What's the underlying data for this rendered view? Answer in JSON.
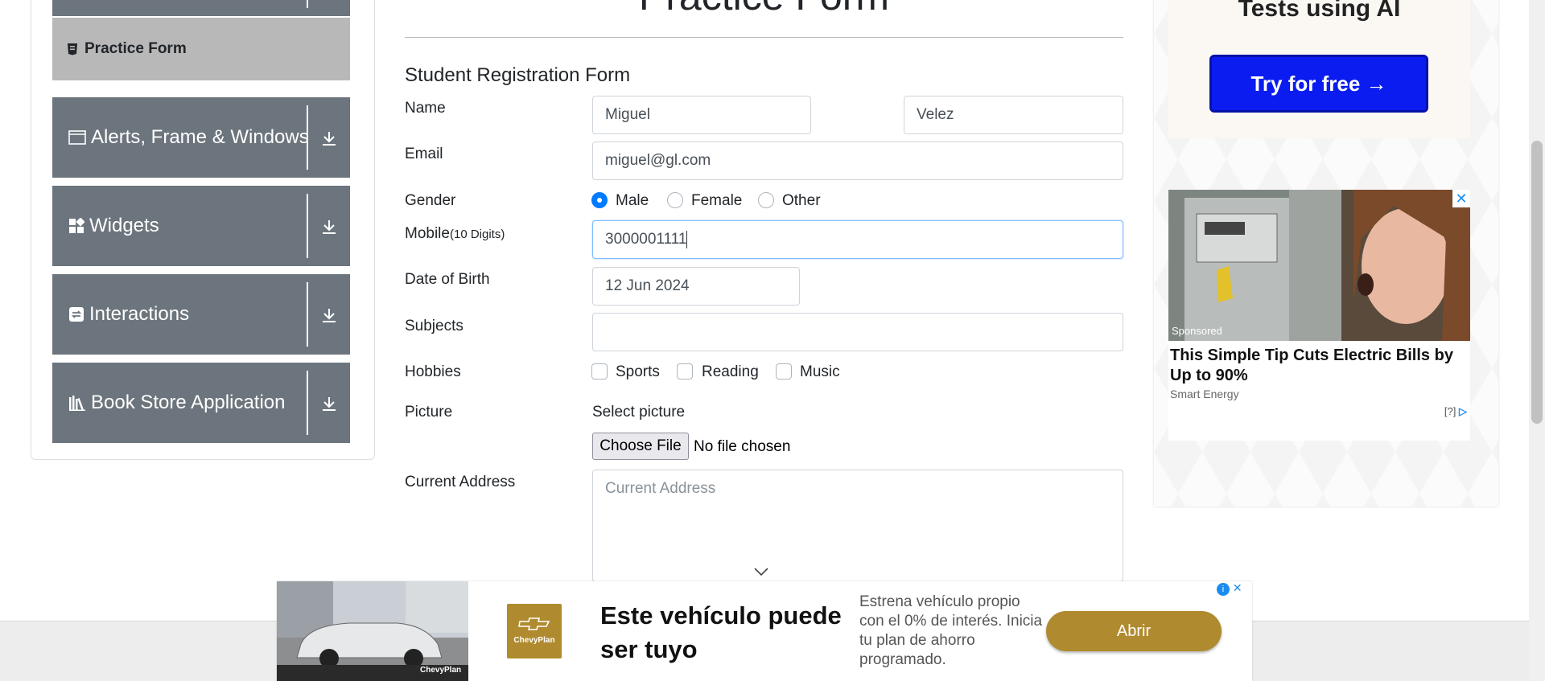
{
  "sidebar": {
    "active_item": "Practice Form",
    "groups": [
      {
        "label": "Alerts, Frame & Windows",
        "icon": "window-icon"
      },
      {
        "label": "Widgets",
        "icon": "widgets-icon"
      },
      {
        "label": "Interactions",
        "icon": "interactions-icon"
      },
      {
        "label": "Book Store Application",
        "icon": "books-icon"
      }
    ]
  },
  "main": {
    "page_title": "Practice Form",
    "form_title": "Student Registration Form",
    "labels": {
      "name": "Name",
      "email": "Email",
      "gender": "Gender",
      "mobile": "Mobile",
      "mobile_hint": "(10 Digits)",
      "dob": "Date of Birth",
      "subjects": "Subjects",
      "hobbies": "Hobbies",
      "picture": "Picture",
      "address": "Current Address"
    },
    "values": {
      "first_name": "Miguel",
      "last_name": "Velez",
      "email": "miguel@gl.com",
      "mobile": "3000001111",
      "dob": "12 Jun 2024",
      "subjects": ""
    },
    "gender_options": [
      "Male",
      "Female",
      "Other"
    ],
    "gender_selected": "Male",
    "hobby_options": [
      "Sports",
      "Reading",
      "Music"
    ],
    "picture": {
      "select_label": "Select picture",
      "button_label": "Choose File",
      "status": "No file chosen"
    },
    "address_placeholder": "Current Address"
  },
  "right_ads": {
    "top_text": "Tests using AI",
    "try_button": "Try for free →",
    "sponsored": "Sponsored",
    "headline": "This Simple Tip Cuts Electric Bills by Up to 90%",
    "brand": "Smart Energy",
    "help": "[?]",
    "close": "✕"
  },
  "bottom_ad": {
    "logo_text": "ChevyPlan",
    "headline": "Este vehículo puede ser tuyo",
    "subtext": "Estrena vehículo propio con el 0% de interés. Inicia tu plan de ahorro programado.",
    "button": "Abrir",
    "image_caption": "ChevyPlan",
    "close": "✕"
  },
  "colors": {
    "sidebar_group": "#6c757d",
    "sidebar_active": "#b8b8b8",
    "primary": "#007bff",
    "try_button": "#0a1cf0",
    "chevy_gold": "#b08a2e"
  }
}
